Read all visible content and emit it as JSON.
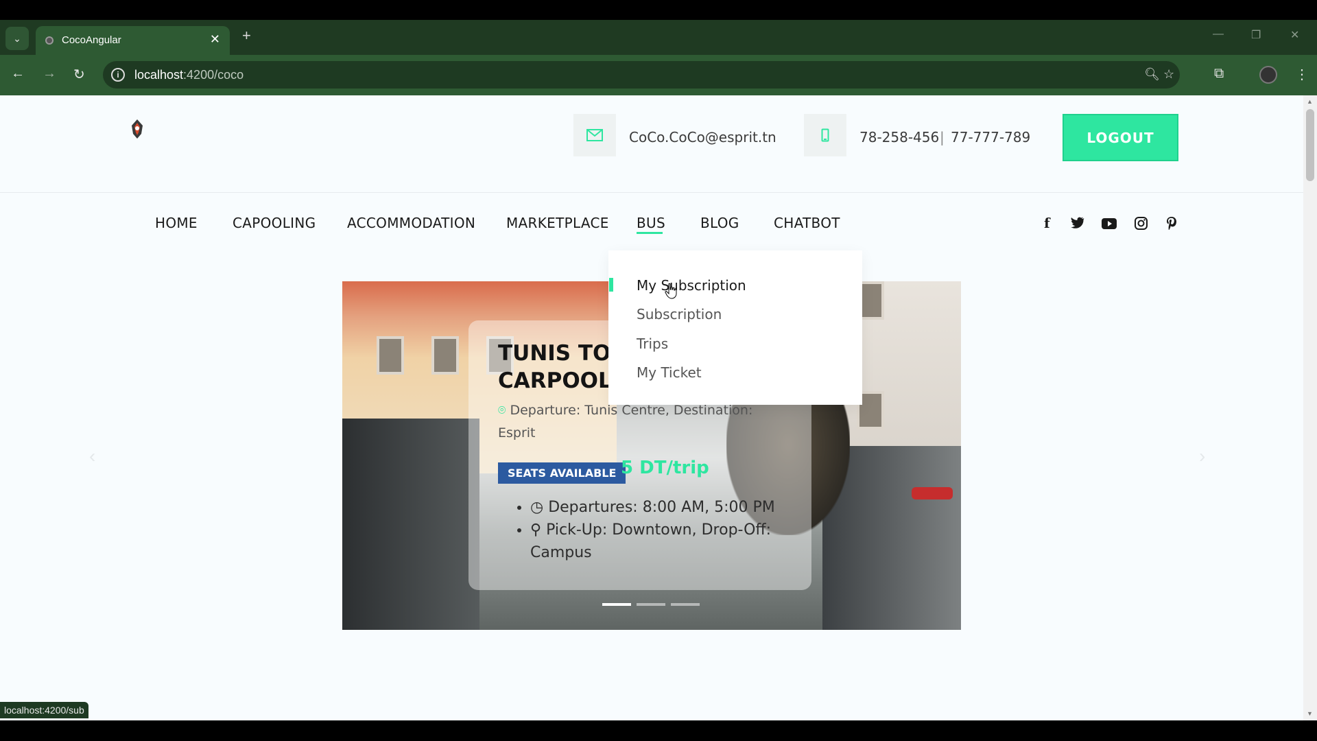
{
  "browser": {
    "tab_title": "CocoAngular",
    "url_host": "localhost",
    "url_path": ":4200/coco",
    "status_url": "localhost:4200/sub"
  },
  "header": {
    "email": "CoCo.CoCo@esprit.tn",
    "phone1": "78-258-456",
    "phone2": "77-777-789",
    "logout_label": "LOGOUT"
  },
  "nav": {
    "items": [
      {
        "label": "HOME"
      },
      {
        "label": "CAPOOLING"
      },
      {
        "label": "ACCOMMODATION"
      },
      {
        "label": "MARKETPLACE"
      },
      {
        "label": "BUS"
      },
      {
        "label": "BLOG"
      },
      {
        "label": "CHATBOT"
      }
    ],
    "active": "BUS"
  },
  "dropdown": {
    "items": [
      {
        "label": "My Subscription"
      },
      {
        "label": "Subscription"
      },
      {
        "label": "Trips"
      },
      {
        "label": "My Ticket"
      }
    ]
  },
  "carousel": {
    "title": "TUNIS TO ESPRIT CARPOOL",
    "title_line1": "TUNIS TO",
    "title_line2": "CARPOOL",
    "route": "Departure: Tunis Centre, Destination: Esprit",
    "badge": "SEATS AVAILABLE",
    "price": "5 DT/trip",
    "details": [
      "Departures: 8:00 AM, 5:00 PM",
      "Pick-Up: Downtown, Drop-Off: Campus"
    ],
    "slide_count": 3,
    "active_slide": 1
  },
  "colors": {
    "accent": "#2ee6a0",
    "badge": "#2c5aa0",
    "browser_frame": "#2e5a33"
  }
}
